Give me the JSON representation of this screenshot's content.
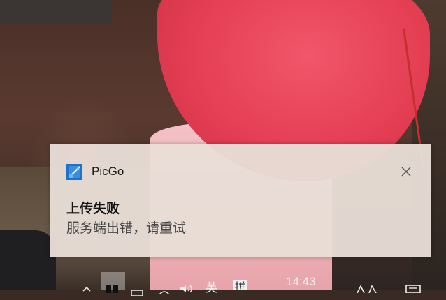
{
  "notification": {
    "app_name": "PicGo",
    "title": "上传失败",
    "message": "服务端出错，请重试",
    "icon": "picgo-app-icon",
    "close_icon": "close-icon"
  },
  "taskbar": {
    "clock": "14:43",
    "ime_lang": "英",
    "ime_mode": "拼"
  }
}
